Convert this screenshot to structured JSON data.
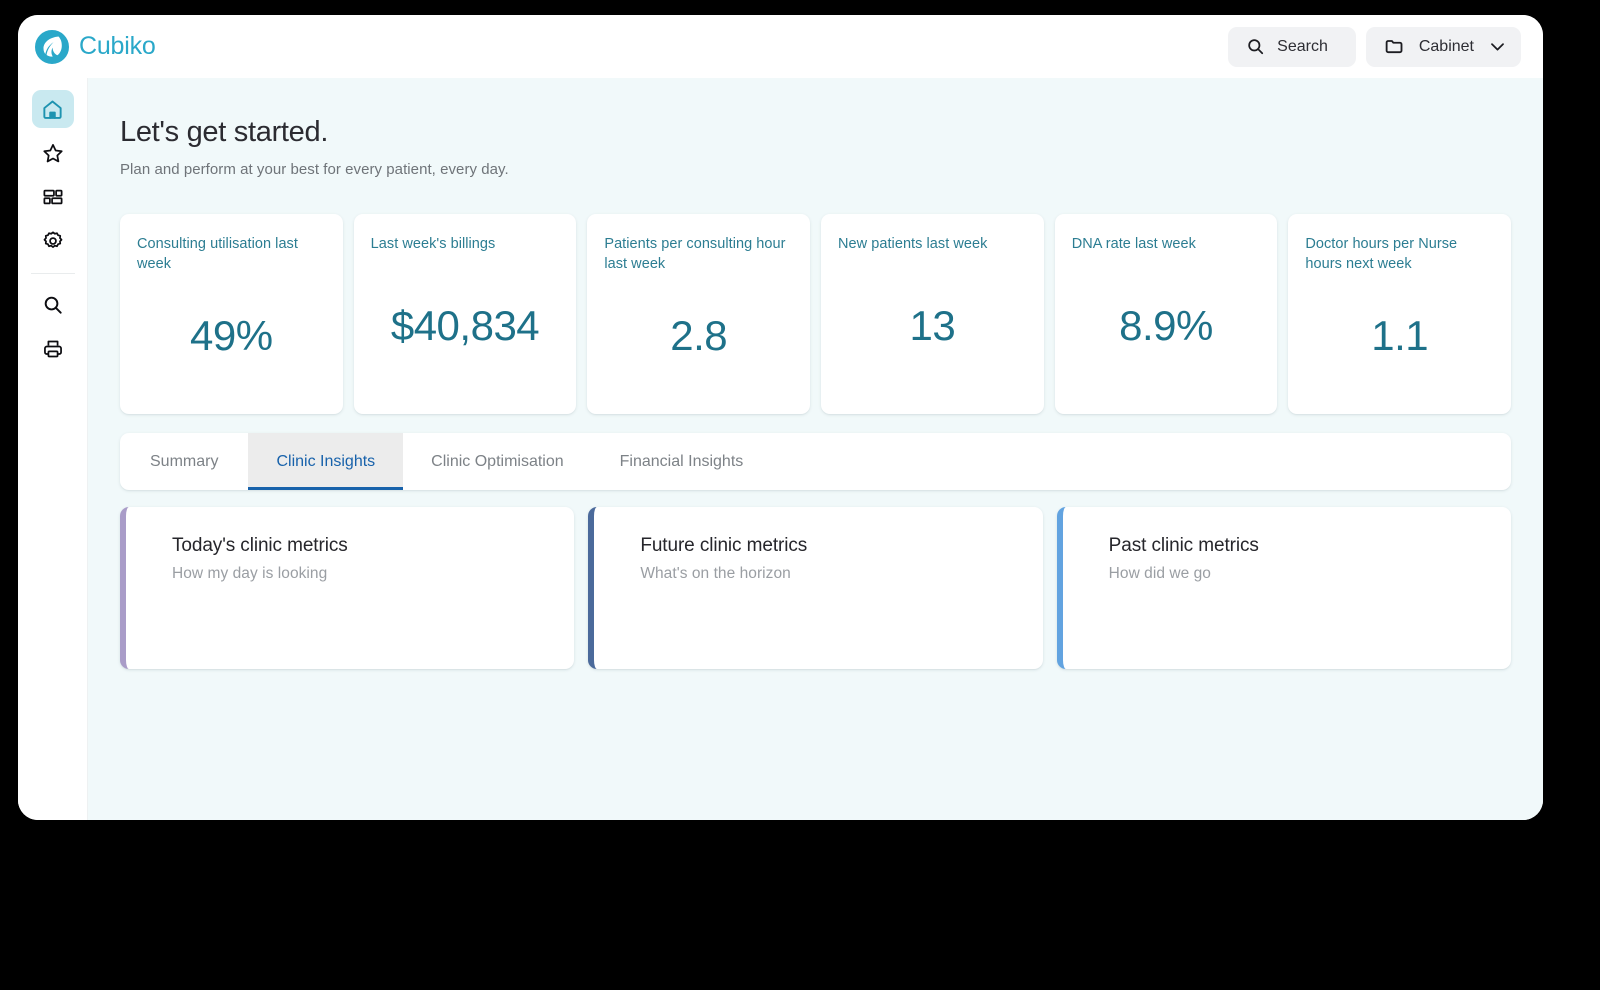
{
  "brand": {
    "name": "Cubiko",
    "logo_icon": "cubiko-leaf-circle-logo",
    "color": "#2aa8c9"
  },
  "topbar": {
    "search": {
      "label": "Search",
      "icon": "search-icon"
    },
    "cabinet": {
      "label": "Cabinet",
      "icon": "folder-icon",
      "chevron": "chevron-down-icon"
    }
  },
  "sidebar": {
    "items": [
      {
        "name": "home",
        "icon": "home-icon",
        "active": true
      },
      {
        "name": "favourites",
        "icon": "star-icon",
        "active": false
      },
      {
        "name": "dashboards",
        "icon": "layout-grid-icon",
        "active": false
      },
      {
        "name": "settings",
        "icon": "gear-icon",
        "active": false
      }
    ],
    "footer_items": [
      {
        "name": "search",
        "icon": "search-icon",
        "active": false
      },
      {
        "name": "print",
        "icon": "printer-icon",
        "active": false
      }
    ]
  },
  "page": {
    "title": "Let's get started.",
    "subtitle": "Plan and perform at your best for every patient, every day."
  },
  "kpis": [
    {
      "title": "Consulting utilisation last week",
      "value": "49%"
    },
    {
      "title": "Last week's billings",
      "value": "$40,834"
    },
    {
      "title": "Patients per consulting hour last week",
      "value": "2.8"
    },
    {
      "title": "New patients last week",
      "value": "13"
    },
    {
      "title": "DNA rate last week",
      "value": "8.9%"
    },
    {
      "title": "Doctor hours per Nurse hours next week",
      "value": "1.1"
    }
  ],
  "tabs": [
    {
      "label": "Summary",
      "active": false
    },
    {
      "label": "Clinic Insights",
      "active": true
    },
    {
      "label": "Clinic Optimisation",
      "active": false
    },
    {
      "label": "Financial Insights",
      "active": false
    }
  ],
  "insight_cards": [
    {
      "title": "Today's clinic metrics",
      "subtitle": "How my day is looking",
      "accent": "#a99cc8"
    },
    {
      "title": "Future clinic metrics",
      "subtitle": "What's on the horizon",
      "accent": "#4b6a9b"
    },
    {
      "title": "Past clinic metrics",
      "subtitle": "How did we go",
      "accent": "#62a3e0"
    }
  ],
  "theme": {
    "accent_teal": "#1e7189",
    "kpi_title_teal": "#2c7d92",
    "active_tab_blue": "#1862ab",
    "canvas_bg": "#f1f9fa",
    "rail_active_bg": "#c9e9f0"
  }
}
